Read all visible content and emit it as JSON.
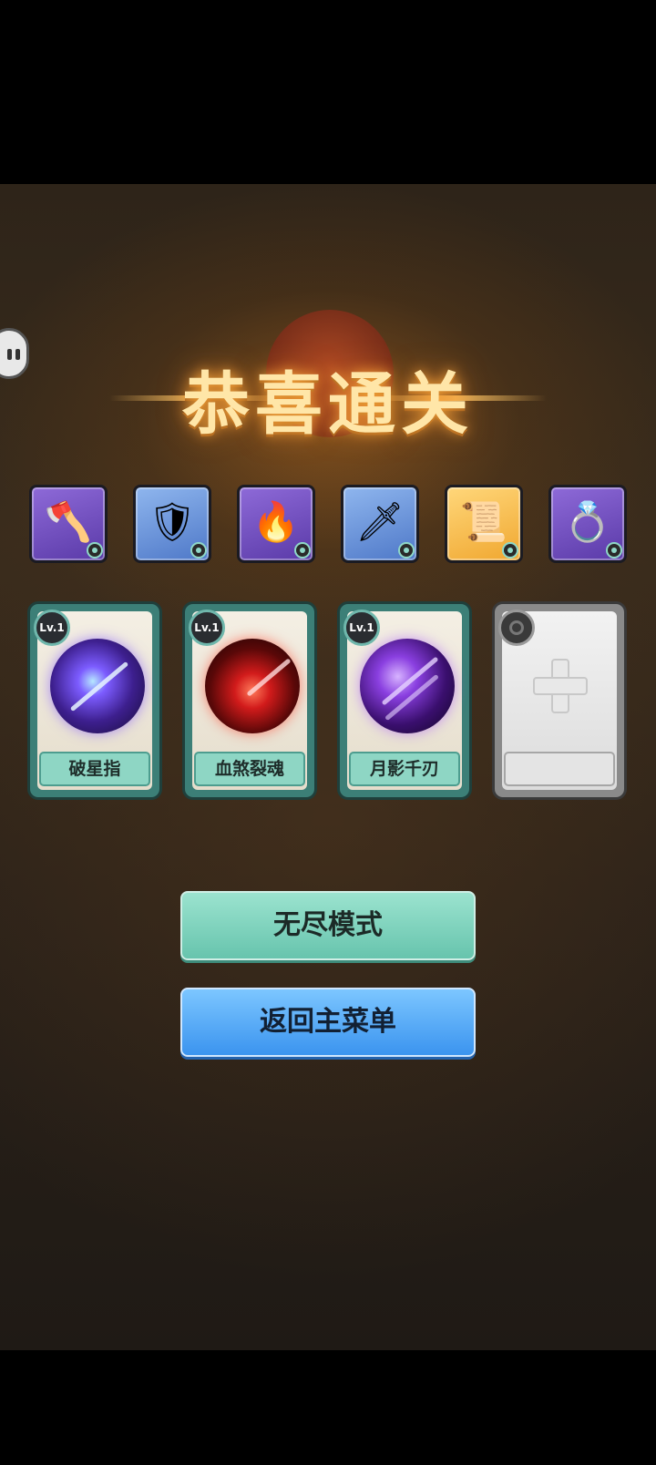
{
  "title": "恭喜通关",
  "items": [
    {
      "icon": "golden-axe-icon",
      "glyph": "🪓",
      "rarity": "purple"
    },
    {
      "icon": "ice-armor-icon",
      "glyph": "🛡",
      "rarity": "blue"
    },
    {
      "icon": "flame-gauntlet-icon",
      "glyph": "🔥",
      "rarity": "purple"
    },
    {
      "icon": "claw-blade-icon",
      "glyph": "🗡",
      "rarity": "blue"
    },
    {
      "icon": "scroll-map-icon",
      "glyph": "📜",
      "rarity": "gold"
    },
    {
      "icon": "dark-ring-icon",
      "glyph": "💍",
      "rarity": "purple"
    }
  ],
  "skills": [
    {
      "level": "Lv.1",
      "name": "破星指",
      "orb": "violet"
    },
    {
      "level": "Lv.1",
      "name": "血煞裂魂",
      "orb": "red"
    },
    {
      "level": "Lv.1",
      "name": "月影千刃",
      "orb": "dark-violet"
    }
  ],
  "buttons": {
    "endless": "无尽模式",
    "main_menu": "返回主菜单"
  },
  "colors": {
    "endless_button": "#7fd3bd",
    "menu_button": "#56a8f5",
    "card_frame": "#3c7f77",
    "title_gold": "#ffe6a8"
  }
}
